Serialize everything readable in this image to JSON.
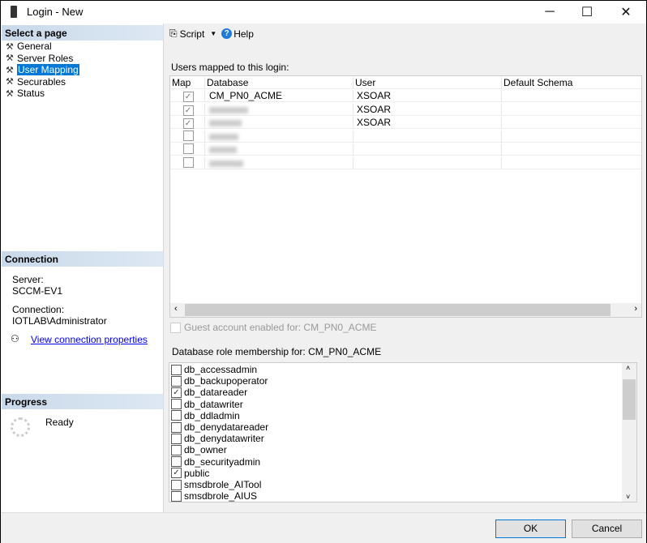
{
  "window": {
    "title": "Login - New",
    "minimize": "─",
    "maximize": "☐",
    "close": "✕"
  },
  "sidebar": {
    "header": "Select a page",
    "items": [
      {
        "label": "General"
      },
      {
        "label": "Server Roles"
      },
      {
        "label": "User Mapping",
        "selected": true
      },
      {
        "label": "Securables"
      },
      {
        "label": "Status"
      }
    ],
    "connection": {
      "header": "Connection",
      "server_label": "Server:",
      "server": "SCCM-EV1",
      "connection_label": "Connection:",
      "connection": "IOTLAB\\Administrator",
      "link": "View connection properties"
    },
    "progress": {
      "header": "Progress",
      "status": "Ready"
    }
  },
  "toolbar": {
    "script": "Script",
    "help": "Help"
  },
  "mapping": {
    "label": "Users mapped to this login:",
    "columns": [
      "Map",
      "Database",
      "User",
      "Default Schema"
    ],
    "rows": [
      {
        "map": true,
        "database": "CM_PN0_ACME",
        "user": "XSOAR"
      },
      {
        "map": true,
        "user": "XSOAR"
      },
      {
        "map": true,
        "user": "XSOAR"
      },
      {
        "map": false
      },
      {
        "map": false
      },
      {
        "map": false
      }
    ]
  },
  "guest": {
    "label": "Guest account enabled for: CM_PN0_ACME",
    "checked": false
  },
  "roles": {
    "label": "Database role membership for: CM_PN0_ACME",
    "items": [
      {
        "name": "db_accessadmin",
        "checked": false
      },
      {
        "name": "db_backupoperator",
        "checked": false
      },
      {
        "name": "db_datareader",
        "checked": true
      },
      {
        "name": "db_datawriter",
        "checked": false
      },
      {
        "name": "db_ddladmin",
        "checked": false
      },
      {
        "name": "db_denydatareader",
        "checked": false
      },
      {
        "name": "db_denydatawriter",
        "checked": false
      },
      {
        "name": "db_owner",
        "checked": false
      },
      {
        "name": "db_securityadmin",
        "checked": false
      },
      {
        "name": "public",
        "checked": true
      },
      {
        "name": "smsdbrole_AITool",
        "checked": false
      },
      {
        "name": "smsdbrole_AIUS",
        "checked": false
      }
    ]
  },
  "buttons": {
    "ok": "OK",
    "cancel": "Cancel"
  }
}
